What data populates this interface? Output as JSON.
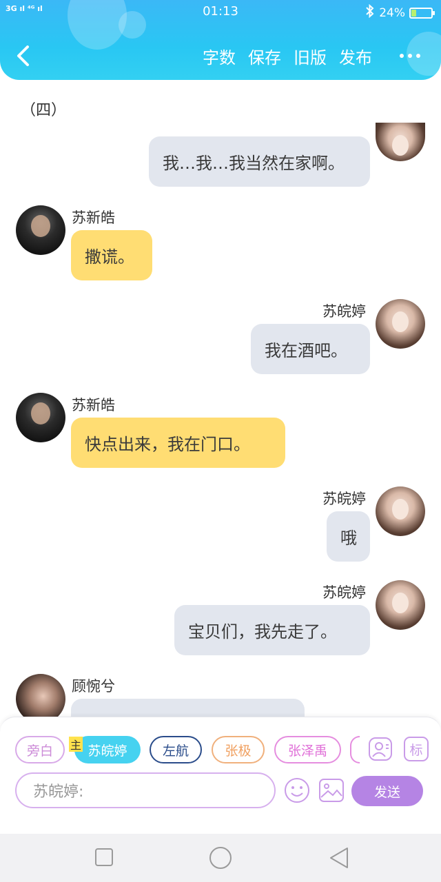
{
  "status_bar": {
    "signal_text": "3G ıl ⁴ᴳ ıl",
    "time": "01:13",
    "battery": "24%",
    "battery_level": 0.24
  },
  "header": {
    "actions": [
      "字数",
      "保存",
      "旧版",
      "发布"
    ]
  },
  "chat": {
    "chapter_title": "（四）",
    "messages": [
      {
        "sender": "",
        "side": "right",
        "text": "我…我…我当然在家啊。"
      },
      {
        "sender": "苏新皓",
        "side": "left",
        "text": "撒谎。"
      },
      {
        "sender": "苏皖婷",
        "side": "right",
        "text": "我在酒吧。"
      },
      {
        "sender": "苏新皓",
        "side": "left",
        "text": "快点出来，我在门口。"
      },
      {
        "sender": "苏皖婷",
        "side": "right",
        "text": "哦"
      },
      {
        "sender": "苏皖婷",
        "side": "right",
        "text": "宝贝们，我先走了。"
      },
      {
        "sender": "顾惋兮",
        "side": "left",
        "text": ""
      }
    ]
  },
  "panel": {
    "main_tag": "主",
    "roles": [
      "旁白",
      "苏皖婷",
      "左航",
      "张极",
      "张泽禹"
    ],
    "tag_label": "标",
    "input_placeholder": "苏皖婷:",
    "send_label": "发送"
  },
  "colors": {
    "header": "#3bb8f6",
    "bubble_left": "#ffdd73",
    "bubble_right": "#e2e6ee",
    "send": "#b584e4",
    "active_role": "#46d2f0"
  }
}
